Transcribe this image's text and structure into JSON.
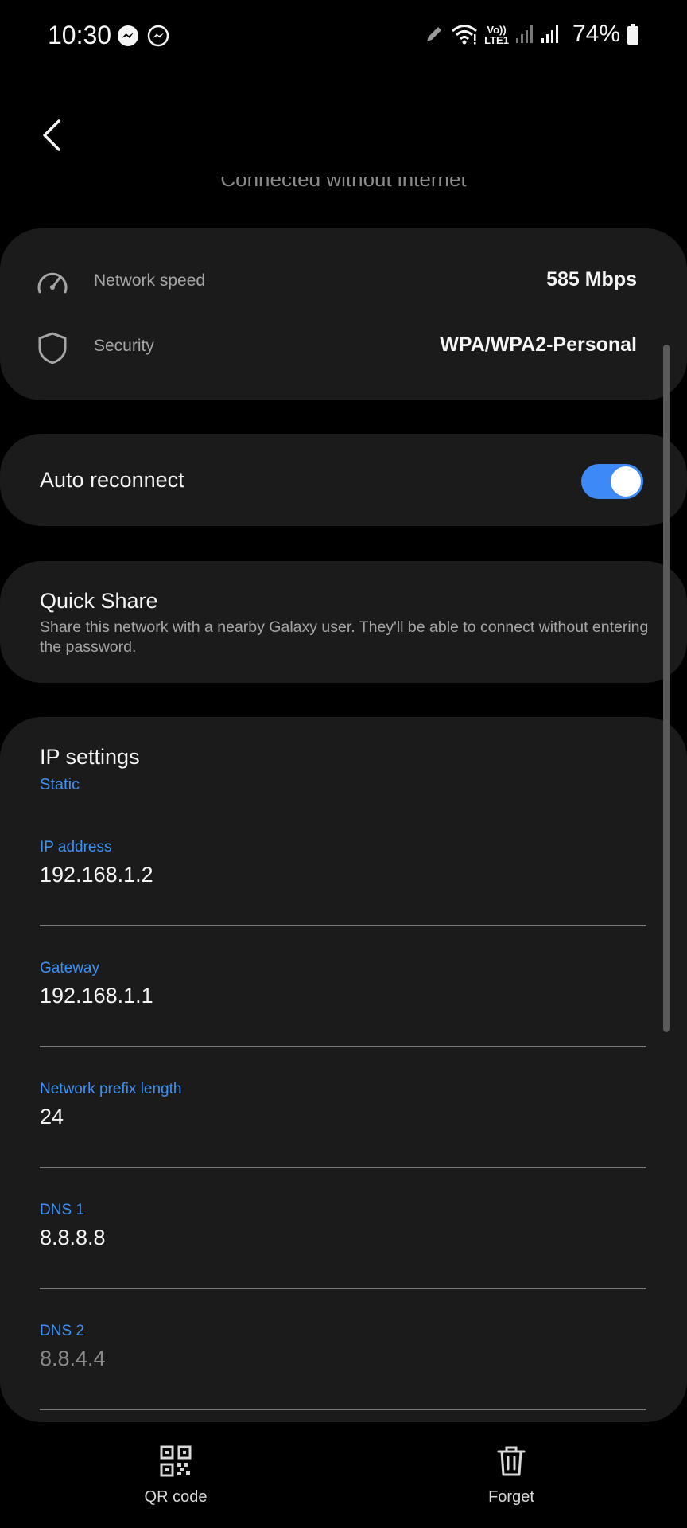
{
  "status_bar": {
    "time": "10:30",
    "lte_top": "Vo))",
    "lte_bottom": "LTE1",
    "battery": "74%"
  },
  "header": {
    "subtitle": "Connected without internet"
  },
  "info": {
    "network_speed_label": "Network speed",
    "network_speed_value": "585 Mbps",
    "security_label": "Security",
    "security_value": "WPA/WPA2-Personal"
  },
  "auto_reconnect": {
    "label": "Auto reconnect",
    "enabled": true
  },
  "quick_share": {
    "title": "Quick Share",
    "description": "Share this network with a nearby Galaxy user. They'll be able to connect without entering the password."
  },
  "ip_settings": {
    "title": "IP settings",
    "mode": "Static",
    "fields": [
      {
        "label": "IP address",
        "value": "192.168.1.2"
      },
      {
        "label": "Gateway",
        "value": "192.168.1.1"
      },
      {
        "label": "Network prefix length",
        "value": "24"
      },
      {
        "label": "DNS 1",
        "value": "8.8.8.8"
      },
      {
        "label": "DNS 2",
        "value": "8.8.4.4"
      }
    ]
  },
  "bottom_bar": {
    "qr_label": "QR code",
    "forget_label": "Forget"
  },
  "colors": {
    "accent": "#3e91f5",
    "toggle_on": "#3d8af7",
    "card_bg": "#1b1b1b"
  },
  "icons": {
    "back": "chevron-left-icon",
    "speed": "speedometer-icon",
    "security": "shield-icon",
    "qr": "qr-code-icon",
    "forget": "trash-icon"
  }
}
